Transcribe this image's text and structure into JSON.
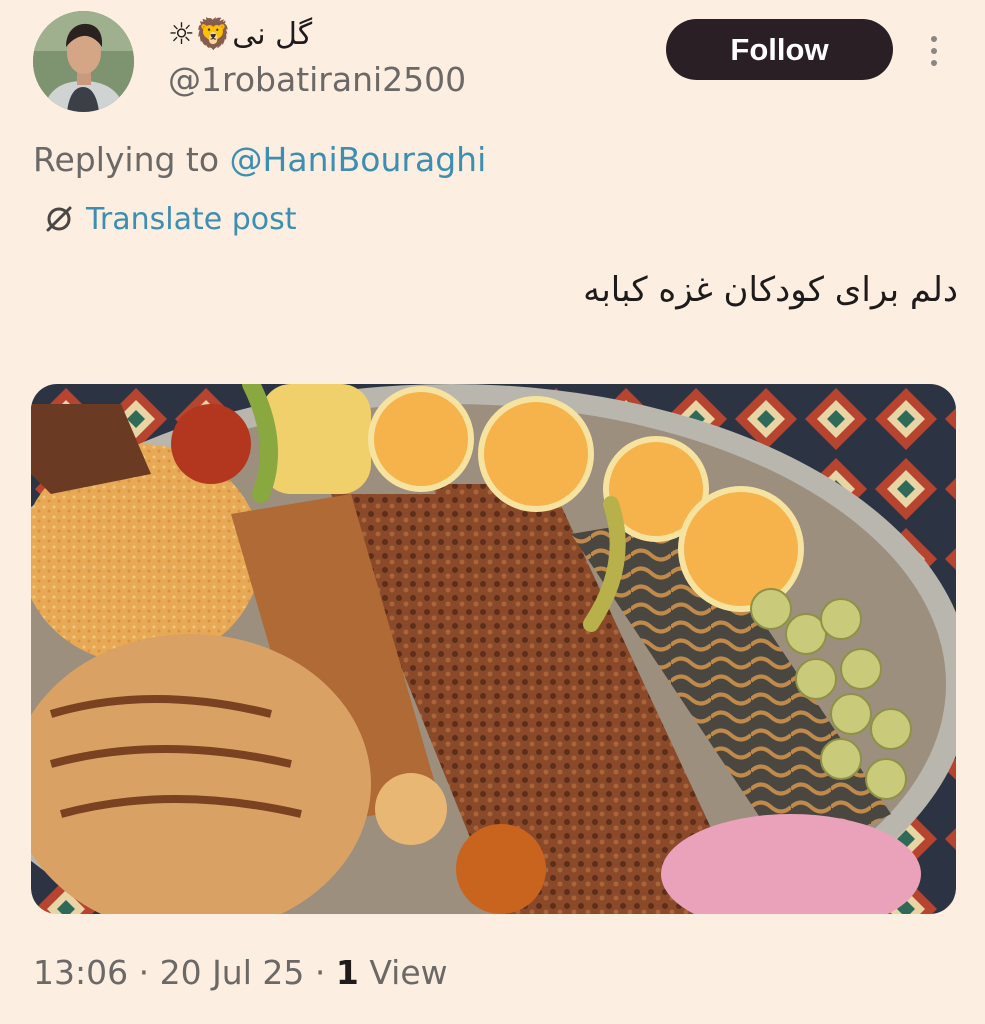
{
  "user": {
    "display_name": "گل نی🦁☼",
    "handle": "@1robatirani2500",
    "avatar_icon": "person-avatar"
  },
  "follow_label": "Follow",
  "more_icon": "vertical-dots-icon",
  "reply": {
    "prefix": "Replying to ",
    "mention": "@HaniBouraghi"
  },
  "translate": {
    "icon": "translate-globe-icon",
    "label": "Translate post"
  },
  "post": {
    "text": "دلم برای کودکان غزه کبابه",
    "image_icon": "kebab-platter-photo"
  },
  "meta": {
    "time": "13:06",
    "sep1": " · ",
    "date": "20 Jul 25",
    "sep2": " · ",
    "views_count": "1",
    "views_label": " View"
  },
  "colors": {
    "background": "#fcefe2",
    "follow_button": "#2a1f24",
    "link": "#3d8eb0",
    "muted_text": "#6c6866"
  }
}
